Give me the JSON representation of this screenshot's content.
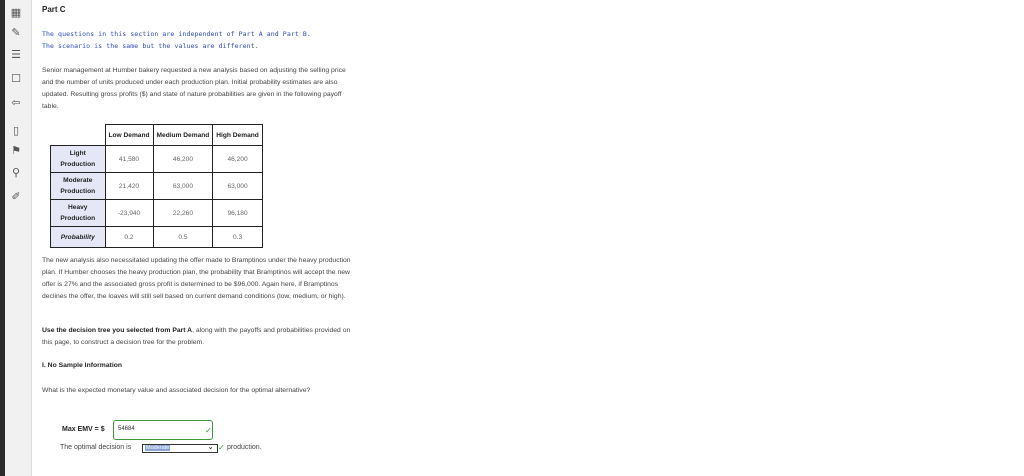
{
  "part_title": "Part C",
  "intro_lines": [
    "The questions in this section are independent of Part A and Part B.",
    "The scenario is the same but the values are different."
  ],
  "paragraph1": "Senior management at Humber bakery requested a new analysis based on adjusting the selling price and the number of units produced under each production plan. Initial probability estimates are also updated. Resulting gross profits ($) and state of nature probabilities are given in the following payoff table.",
  "table": {
    "headers": [
      "",
      "Low Demand",
      "Medium Demand",
      "High Demand"
    ],
    "rows": [
      {
        "label": "Light Production",
        "values": [
          "41,580",
          "46,200",
          "46,200"
        ]
      },
      {
        "label": "Moderate Production",
        "values": [
          "21,420",
          "63,000",
          "63,000"
        ]
      },
      {
        "label": "Heavy Production",
        "values": [
          "-23,940",
          "22,260",
          "96,180"
        ]
      }
    ],
    "probability_label": "Probability",
    "probabilities": [
      "0.2",
      "0.5",
      "0.3"
    ]
  },
  "paragraph2": "The new analysis also necessitated updating the offer made to Bramptinos under the heavy production plan. If Humber chooses the heavy production plan, the probability that Bramptinos will accept the new offer is 27% and the associated gross profit is determined to be $96,000. Again here, if Bramptinos declines the offer, the loaves will still sell based on current demand conditions (low, medium, or high).",
  "paragraph3_bold": "Use the decision tree you selected from Part A",
  "paragraph3_rest": ", along with the payoffs and probabilities provided on this page, to construct a decision tree for the problem.",
  "section_heading": "I. No Sample Information",
  "question": "What is the expected monetary value and associated decision for the optimal alternative?",
  "emv_label": "Max EMV = $",
  "emv_value": "54684",
  "decision_prefix": "The optimal decision is",
  "decision_value": "Moderate",
  "decision_suffix": "production.",
  "accent_color": "#3a9a3a"
}
